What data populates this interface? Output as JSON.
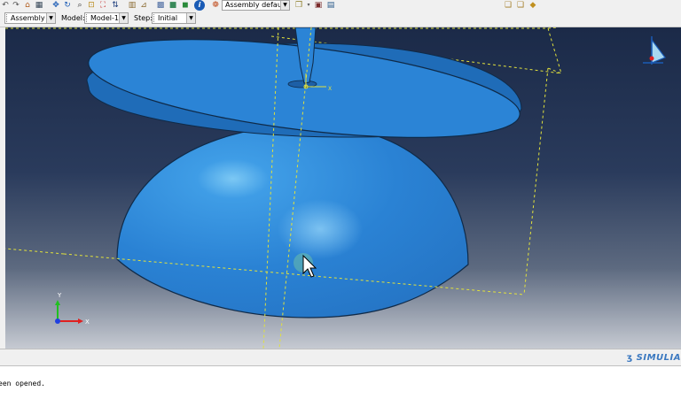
{
  "toolbar": {
    "render_style_value": "Assembly defaults",
    "icons": [
      "undo-icon",
      "redo-icon",
      "home-icon",
      "print-icon",
      "pan-icon",
      "rotate-icon",
      "magnify-icon",
      "zoom-box-icon",
      "auto-fit-icon",
      "cycle-views-icon",
      "view-front-icon",
      "view-iso-icon",
      "render-shaded-icon",
      "info-icon",
      "color-code-icon",
      "palette-icon",
      "query-icon",
      "spreadsheet-icon",
      "assembly-icon",
      "translate-icon",
      "instance-icon"
    ]
  },
  "context_bar": {
    "module_value": "Assembly",
    "model_label": "Model:",
    "model_value": "Model-1",
    "step_label": "Step:",
    "step_value": "Initial"
  },
  "viewport": {
    "triad": {
      "x_label": "X",
      "y_label": "Y"
    },
    "datum_axis_label": "X"
  },
  "messages": {
    "brand": "SIMULIA",
    "lines": [
      "een opened."
    ]
  },
  "colors": {
    "part_blue": "#2b84d6",
    "datum_yellow": "#e2e23c",
    "brand_blue": "#3a78c0"
  }
}
